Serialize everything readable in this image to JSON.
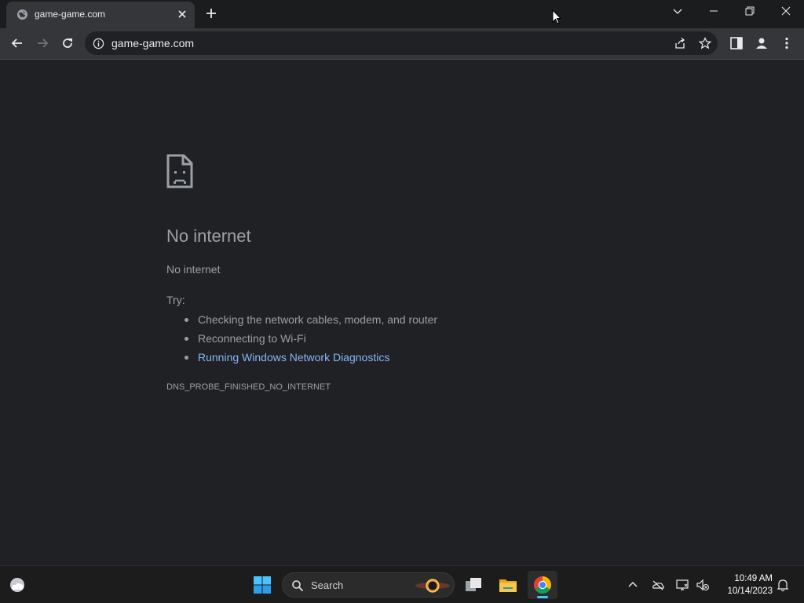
{
  "browser": {
    "tab": {
      "title": "game-game.com",
      "favicon": "globe-icon"
    },
    "toolbar": {
      "url": "game-game.com",
      "icons": [
        "back-icon",
        "forward-icon",
        "reload-icon",
        "info-icon",
        "share-icon",
        "star-icon",
        "side-panel-icon",
        "profile-icon",
        "menu-icon"
      ]
    },
    "window_controls": [
      "tab-search-icon",
      "minimize-icon",
      "restore-icon",
      "close-icon"
    ]
  },
  "error_page": {
    "icon": "sad-page-icon",
    "heading": "No internet",
    "message": "No internet",
    "try_label": "Try:",
    "suggestions": [
      {
        "text": "Checking the network cables, modem, and router",
        "is_link": false
      },
      {
        "text": "Reconnecting to Wi-Fi",
        "is_link": false
      },
      {
        "text": "Running Windows Network Diagnostics",
        "is_link": true
      }
    ],
    "error_code": "DNS_PROBE_FINISHED_NO_INTERNET"
  },
  "taskbar": {
    "search_label": "Search",
    "apps": [
      "task-view-icon",
      "file-explorer-icon",
      "chrome-icon"
    ],
    "active_app": "chrome-icon",
    "tray_icons": [
      "chevron-up-icon",
      "onedrive-icon",
      "network-icon",
      "volume-icon",
      "notification-icon"
    ],
    "time": "10:49 AM",
    "date": "10/14/2023"
  },
  "colors": {
    "page_background": "#202124",
    "text": "#9aa0a6",
    "link": "#8ab4f8",
    "toolbar": "#35363a",
    "taskbar": "#1c1c1c",
    "accent": "#4cc2ff"
  }
}
